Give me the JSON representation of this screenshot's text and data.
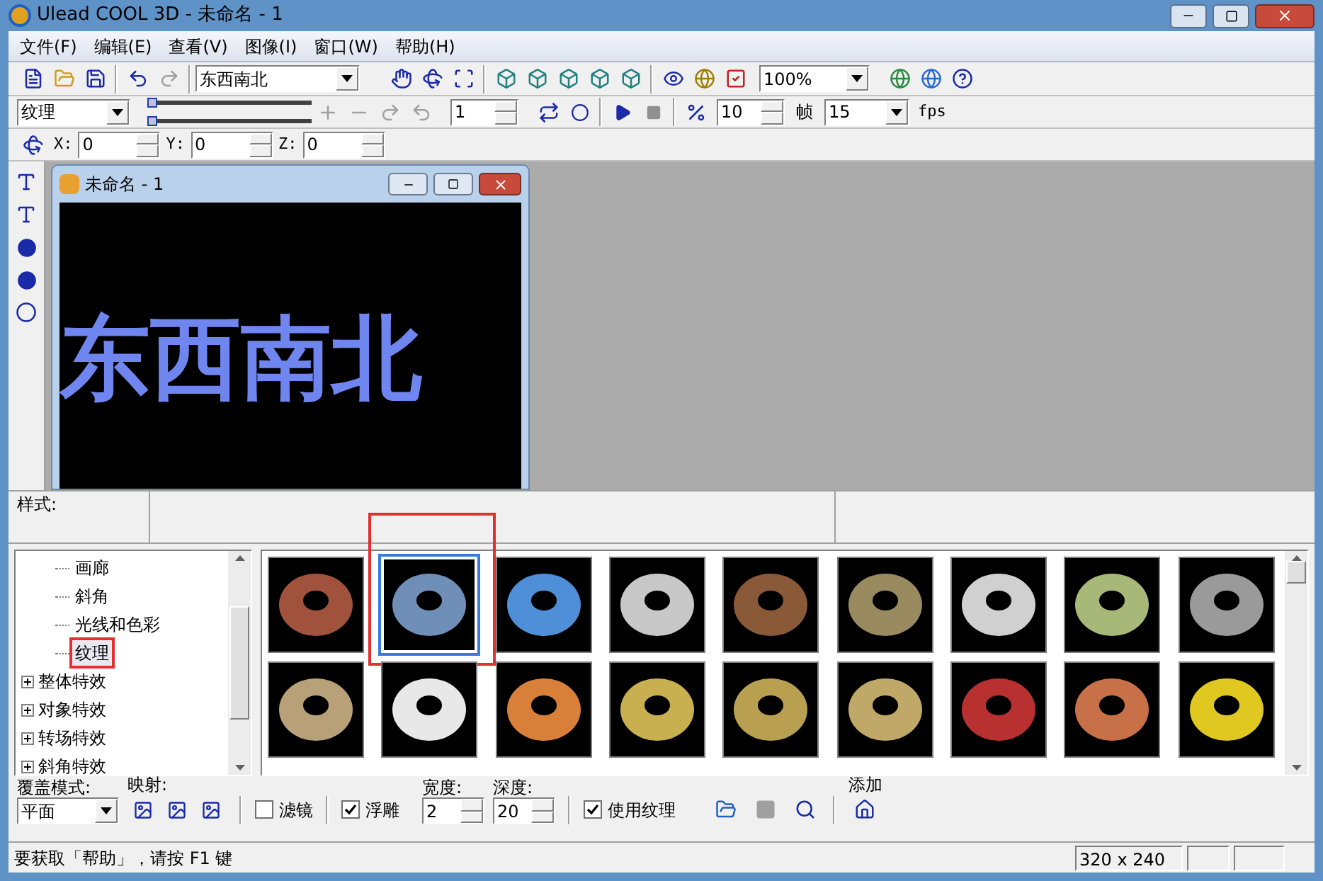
{
  "window": {
    "title": "Ulead COOL 3D - 未命名 - 1"
  },
  "menu": [
    "文件(F)",
    "编辑(E)",
    "查看(V)",
    "图像(I)",
    "窗口(W)",
    "帮助(H)"
  ],
  "toolbar1": {
    "text_combo": "东西南北",
    "zoom_combo": "100%"
  },
  "toolbar2": {
    "category_combo": "纹理",
    "sliders": [
      {
        "level": 0
      },
      {
        "level": 0
      }
    ],
    "frame_spin": "1",
    "step_spin": "10",
    "frame_label": "帧",
    "fps_combo": "15",
    "fps_button": "fps"
  },
  "toolbar3": {
    "coords": [
      {
        "label": "X:",
        "value": "0"
      },
      {
        "label": "Y:",
        "value": "0"
      },
      {
        "label": "Z:",
        "value": "0"
      }
    ]
  },
  "document": {
    "title": "未命名 - 1",
    "canvas_text": "东西南北"
  },
  "style_panel": {
    "label": "样式:"
  },
  "tree": {
    "items": [
      {
        "label": "画廊",
        "kind": "child",
        "selected": false,
        "annotated": false
      },
      {
        "label": "斜角",
        "kind": "child",
        "selected": false,
        "annotated": false
      },
      {
        "label": "光线和色彩",
        "kind": "child",
        "selected": false,
        "annotated": false
      },
      {
        "label": "纹理",
        "kind": "child",
        "selected": true,
        "annotated": true
      },
      {
        "label": "整体特效",
        "kind": "node",
        "expanded": false
      },
      {
        "label": "对象特效",
        "kind": "node",
        "expanded": false
      },
      {
        "label": "转场特效",
        "kind": "node",
        "expanded": false
      },
      {
        "label": "斜角特效",
        "kind": "node",
        "expanded": false
      }
    ]
  },
  "thumbnails": [
    {
      "color": "#a0523c",
      "selected": false,
      "annotated": false
    },
    {
      "color": "#6f8fb8",
      "selected": true,
      "annotated": true
    },
    {
      "color": "#4f8fd8",
      "selected": false,
      "annotated": false
    },
    {
      "color": "#c8c8c8",
      "selected": false,
      "annotated": false
    },
    {
      "color": "#8a5a38",
      "selected": false,
      "annotated": false
    },
    {
      "color": "#9a8a60",
      "selected": false,
      "annotated": false
    },
    {
      "color": "#d0d0d0",
      "selected": false,
      "annotated": false
    },
    {
      "color": "#a8b878",
      "selected": false,
      "annotated": false
    },
    {
      "color": "#9a9a9a",
      "selected": false,
      "annotated": false
    },
    {
      "color": "#b8a078",
      "selected": false,
      "annotated": false
    },
    {
      "color": "#e8e8e8",
      "selected": false,
      "annotated": false
    },
    {
      "color": "#d8803a",
      "selected": false,
      "annotated": false
    },
    {
      "color": "#c8b050",
      "selected": false,
      "annotated": false
    },
    {
      "color": "#b8a050",
      "selected": false,
      "annotated": false
    },
    {
      "color": "#c0a868",
      "selected": false,
      "annotated": false
    },
    {
      "color": "#b83030",
      "selected": false,
      "annotated": false
    },
    {
      "color": "#c87048",
      "selected": false,
      "annotated": false
    },
    {
      "color": "#e0c820",
      "selected": false,
      "annotated": false
    }
  ],
  "options": {
    "mode_label": "覆盖模式:",
    "mode_combo": "平面",
    "mapping_label": "映射:",
    "checks": [
      {
        "label": "滤镜",
        "checked": false
      },
      {
        "label": "浮雕",
        "checked": true
      }
    ],
    "width_label": "宽度:",
    "width_value": "2",
    "depth_label": "深度:",
    "depth_value": "20",
    "use_texture": {
      "label": "使用纹理",
      "checked": true
    },
    "add_label": "添加"
  },
  "status_bar": {
    "message": "要获取「帮助」，请按 F1 键",
    "size": "320 x 240"
  }
}
